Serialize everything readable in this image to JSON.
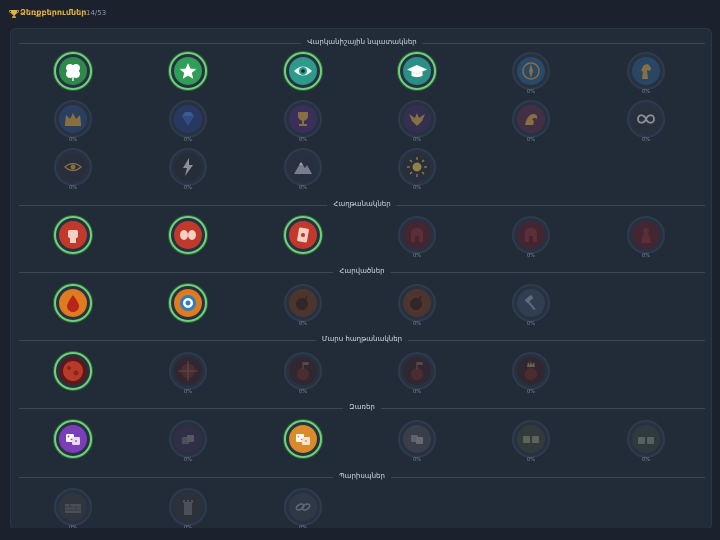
{
  "header": {
    "title": "Ձեռքբերումներ",
    "count": "14/53"
  },
  "colors": {
    "accent": "#e8b13c",
    "unlocked_ring": "#6fd17a",
    "locked_ring": "#2f3b4c"
  },
  "sections": [
    {
      "label": "Վարկանիշային նպատակներ",
      "badges": [
        {
          "icon": "clover-icon",
          "unlocked": true,
          "pct": ""
        },
        {
          "icon": "star-icon",
          "unlocked": true,
          "pct": ""
        },
        {
          "icon": "eye-icon",
          "unlocked": true,
          "pct": ""
        },
        {
          "icon": "graduation-cap-icon",
          "unlocked": true,
          "pct": ""
        },
        {
          "icon": "compass-icon",
          "unlocked": false,
          "pct": "0%"
        },
        {
          "icon": "horse-icon",
          "unlocked": false,
          "pct": "0%"
        },
        {
          "icon": "crown-icon",
          "unlocked": false,
          "pct": "0%"
        },
        {
          "icon": "diamond-icon",
          "unlocked": false,
          "pct": "0%"
        },
        {
          "icon": "trophy-icon",
          "unlocked": false,
          "pct": "0%"
        },
        {
          "icon": "phoenix-icon",
          "unlocked": false,
          "pct": "0%"
        },
        {
          "icon": "dragon-icon",
          "unlocked": false,
          "pct": "0%"
        },
        {
          "icon": "infinity-icon",
          "unlocked": false,
          "pct": "0%"
        },
        {
          "icon": "all-seeing-eye-icon",
          "unlocked": false,
          "pct": "0%"
        },
        {
          "icon": "lightning-icon",
          "unlocked": false,
          "pct": "0%"
        },
        {
          "icon": "mountain-icon",
          "unlocked": false,
          "pct": "0%"
        },
        {
          "icon": "sun-icon",
          "unlocked": false,
          "pct": "0%"
        }
      ]
    },
    {
      "label": "Հաղթանակներ",
      "badges": [
        {
          "icon": "fist-icon",
          "unlocked": true,
          "pct": ""
        },
        {
          "icon": "boxing-gloves-icon",
          "unlocked": true,
          "pct": ""
        },
        {
          "icon": "card-icon",
          "unlocked": true,
          "pct": ""
        },
        {
          "icon": "spartan-helmet-icon",
          "unlocked": false,
          "pct": "0%"
        },
        {
          "icon": "spartan-helmet-icon",
          "unlocked": false,
          "pct": "0%"
        },
        {
          "icon": "warrior-icon",
          "unlocked": false,
          "pct": "0%"
        }
      ]
    },
    {
      "label": "Հարվածներ",
      "badges": [
        {
          "icon": "blood-drop-icon",
          "unlocked": true,
          "pct": ""
        },
        {
          "icon": "target-icon",
          "unlocked": true,
          "pct": ""
        },
        {
          "icon": "bomb-icon",
          "unlocked": false,
          "pct": "0%"
        },
        {
          "icon": "bomb-icon",
          "unlocked": false,
          "pct": "0%"
        },
        {
          "icon": "hammer-icon",
          "unlocked": false,
          "pct": "0%"
        }
      ]
    },
    {
      "label": "Մարս հաղթանակներ",
      "badges": [
        {
          "icon": "planet-mars-icon",
          "unlocked": true,
          "pct": ""
        },
        {
          "icon": "crosshair-planet-icon",
          "unlocked": false,
          "pct": "0%"
        },
        {
          "icon": "mars-flag-icon",
          "unlocked": false,
          "pct": "0%"
        },
        {
          "icon": "mars-flag-icon",
          "unlocked": false,
          "pct": "0%"
        },
        {
          "icon": "mars-crown-icon",
          "unlocked": false,
          "pct": "0%"
        }
      ]
    },
    {
      "label": "Զառեր",
      "badges": [
        {
          "icon": "dice-purple-icon",
          "unlocked": true,
          "pct": ""
        },
        {
          "icon": "dice-stack-icon",
          "unlocked": false,
          "pct": "0%"
        },
        {
          "icon": "dice-orange-icon",
          "unlocked": true,
          "pct": ""
        },
        {
          "icon": "dice-gray-icon",
          "unlocked": false,
          "pct": "0%"
        },
        {
          "icon": "dice-pair-icon",
          "unlocked": false,
          "pct": "0%"
        },
        {
          "icon": "dice-green-icon",
          "unlocked": false,
          "pct": "0%"
        }
      ]
    },
    {
      "label": "Պարիսպներ",
      "badges": [
        {
          "icon": "wall-icon",
          "unlocked": false,
          "pct": "0%"
        },
        {
          "icon": "tower-icon",
          "unlocked": false,
          "pct": "0%"
        },
        {
          "icon": "chain-icon",
          "unlocked": false,
          "pct": "0%"
        }
      ]
    }
  ]
}
